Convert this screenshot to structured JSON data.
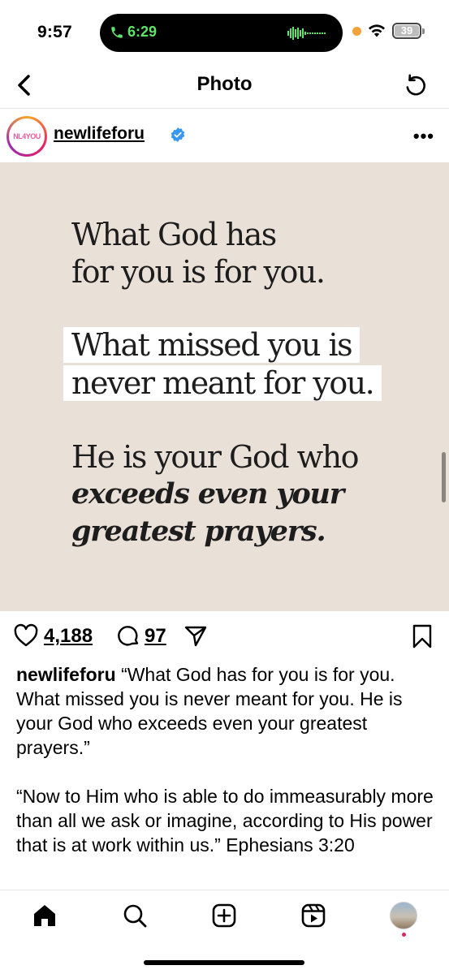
{
  "status_bar": {
    "time": "9:57",
    "call_timer": "6:29",
    "battery": "39",
    "colors": {
      "call_green": "#5fe36a",
      "privacy_dot": "#f2a33a"
    }
  },
  "header": {
    "title": "Photo",
    "back_icon": "chevron-left-icon",
    "refresh_icon": "refresh-icon"
  },
  "post": {
    "username": "newlifeforu",
    "avatar_text": "NL4YOU",
    "verified": true,
    "more_icon": "more-dots-icon",
    "image": {
      "background": "#e9e1d8",
      "line1": "What God has",
      "line2": "for you is for you.",
      "line3": "What missed you is",
      "line4": "never meant for you.",
      "line5": "He is your God who",
      "line6": "exceeds even your",
      "line7": "greatest prayers."
    },
    "likes": "4,188",
    "comments": "97",
    "caption_user": "newlifeforu",
    "caption_text": "“What God has for you is for you. What missed you is never meant for you. He is your God who exceeds even your greatest prayers.”",
    "caption_verse": " “Now to Him who is able to do immeasurably more than all we ask or imagine, according to His power that is at work within us.” Ephesians 3:20"
  },
  "bottom_nav": {
    "tabs": [
      "home-icon",
      "search-icon",
      "create-icon",
      "reels-icon",
      "profile-avatar"
    ],
    "notification_color": "#e0245e"
  }
}
